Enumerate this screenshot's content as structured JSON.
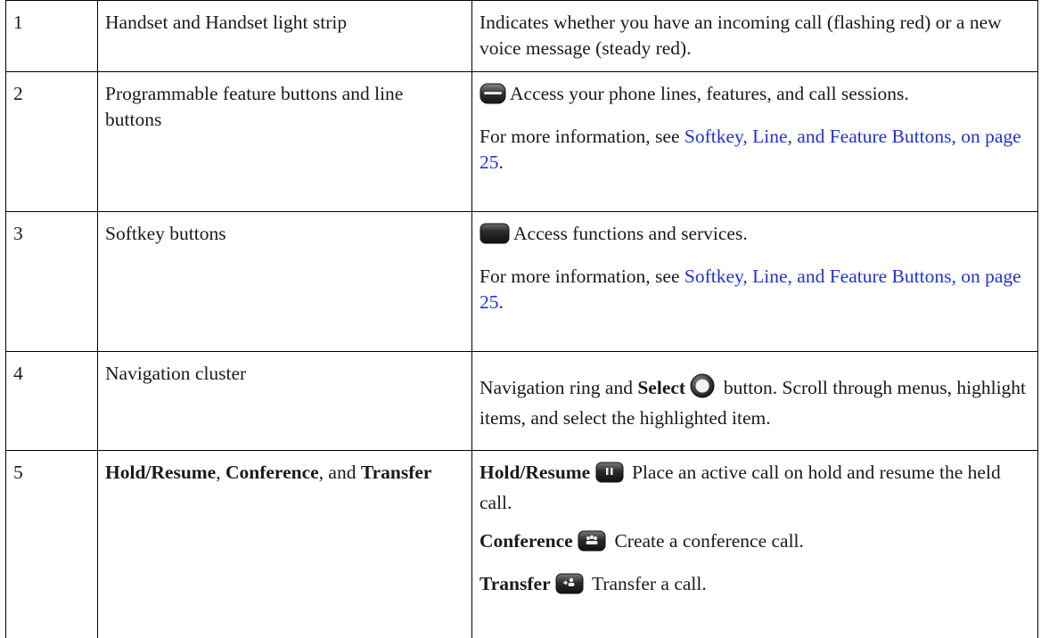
{
  "rows": [
    {
      "num": "1",
      "item": "Handset and Handset light strip",
      "desc": "Indicates whether you have an incoming call (flashing red) or a new voice message (steady red)."
    },
    {
      "num": "2",
      "item": "Programmable feature buttons and line buttons",
      "icon": "line-button-icon",
      "desc": "Access your phone lines, features, and call sessions.",
      "more_prefix": "For more information, see ",
      "more_link": "Softkey, Line, and Feature Buttons, on page 25",
      "more_suffix": "."
    },
    {
      "num": "3",
      "item": "Softkey buttons",
      "icon": "softkey-button-icon",
      "desc": "Access functions and services.",
      "more_prefix": "For more information, see ",
      "more_link": "Softkey, Line, and Feature Buttons, on page 25",
      "more_suffix": "."
    },
    {
      "num": "4",
      "item": "Navigation cluster",
      "desc_pre": "Navigation ring and ",
      "desc_bold": "Select",
      "icon": "select-ring-icon",
      "desc_post": " button. Scroll through menus, highlight items, and select the highlighted item."
    },
    {
      "num": "5",
      "item_bold1": "Hold/Resume",
      "item_sep1": ", ",
      "item_bold2": "Conference",
      "item_sep2": ", and ",
      "item_bold3": "Transfer",
      "entries": [
        {
          "label": "Hold/Resume",
          "icon": "hold-icon",
          "text": " Place an active call on hold and resume the held call."
        },
        {
          "label": "Conference",
          "icon": "conference-icon",
          "text": " Create a conference call."
        },
        {
          "label": "Transfer",
          "icon": "transfer-icon",
          "text": " Transfer a call."
        }
      ]
    }
  ],
  "colors": {
    "link": "#2233cc",
    "border": "#000000"
  }
}
